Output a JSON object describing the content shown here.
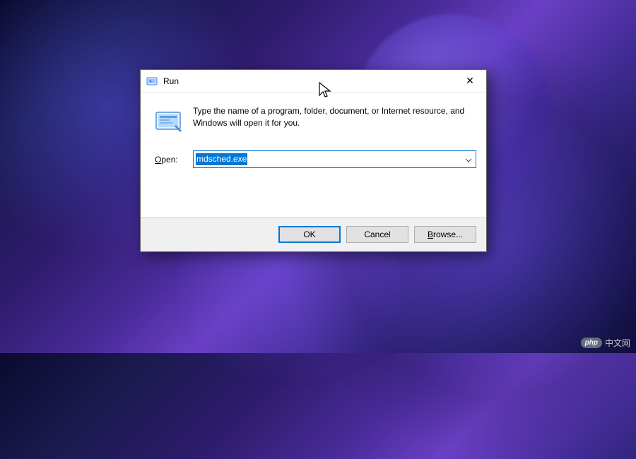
{
  "dialog": {
    "title": "Run",
    "instruction": "Type the name of a program, folder, document, or Internet resource, and Windows will open it for you.",
    "open_label": "Open:",
    "open_mnemonic": "O",
    "input_value": "mdsched.exe",
    "buttons": {
      "ok": "OK",
      "cancel": "Cancel",
      "browse": "Browse...",
      "browse_mnemonic": "B"
    }
  },
  "watermark": {
    "badge": "php",
    "text": "中文网"
  }
}
